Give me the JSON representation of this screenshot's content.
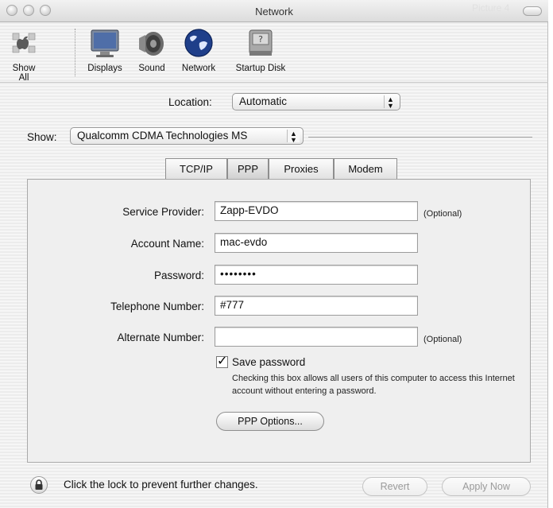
{
  "window": {
    "title": "Network",
    "ghost_title": "Picture 4"
  },
  "toolbar": {
    "items": [
      {
        "label": "Show All",
        "icon": "apple-show-all-icon"
      },
      {
        "label": "Displays",
        "icon": "display-monitor-icon"
      },
      {
        "label": "Sound",
        "icon": "speaker-icon"
      },
      {
        "label": "Network",
        "icon": "globe-icon"
      },
      {
        "label": "Startup Disk",
        "icon": "hard-disk-icon"
      }
    ]
  },
  "location": {
    "label": "Location:",
    "value": "Automatic"
  },
  "show": {
    "label": "Show:",
    "value": "Qualcomm CDMA Technologies MS"
  },
  "tabs": [
    {
      "label": "TCP/IP",
      "selected": false
    },
    {
      "label": "PPP",
      "selected": true
    },
    {
      "label": "Proxies",
      "selected": false
    },
    {
      "label": "Modem",
      "selected": false
    }
  ],
  "form": {
    "service_provider": {
      "label": "Service Provider:",
      "value": "Zapp-EVDO",
      "note": "(Optional)"
    },
    "account_name": {
      "label": "Account Name:",
      "value": "mac-evdo"
    },
    "password": {
      "label": "Password:",
      "value": "••••••••"
    },
    "telephone": {
      "label": "Telephone Number:",
      "value": "#777"
    },
    "alternate": {
      "label": "Alternate Number:",
      "value": "",
      "note": "(Optional)"
    }
  },
  "save_password": {
    "label": "Save password",
    "checked": true,
    "mark": "✓",
    "note": "Checking this box allows all users of this computer to access this Internet account without entering a password."
  },
  "buttons": {
    "ppp_options": "PPP Options...",
    "revert": "Revert",
    "apply_now": "Apply Now"
  },
  "footer": {
    "lock_text": "Click the lock to prevent further changes."
  },
  "colors": {
    "selected_tab": "#d0d0d0",
    "disabled_text": "#9a9a9a"
  }
}
